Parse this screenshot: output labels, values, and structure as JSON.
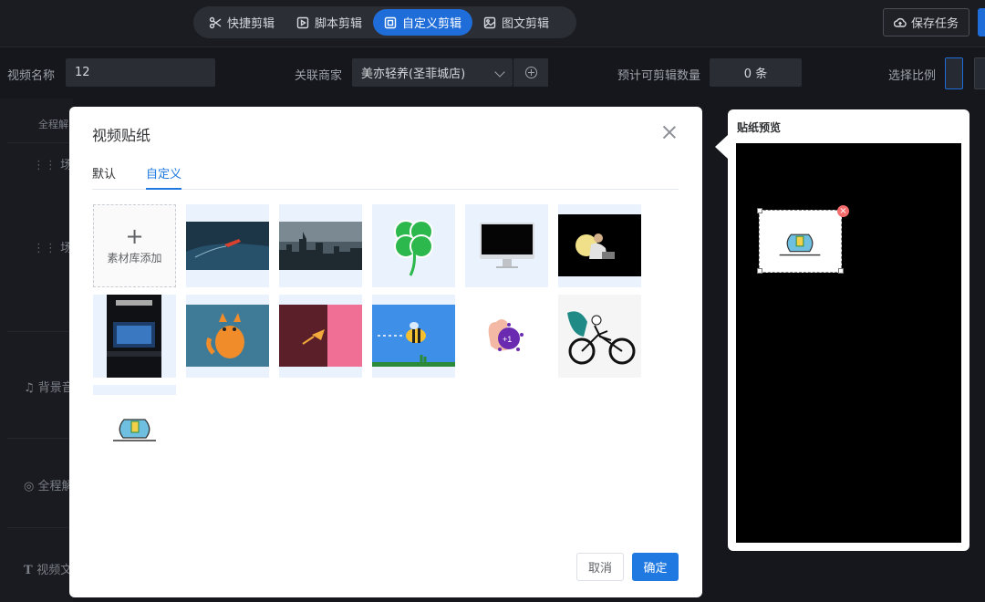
{
  "topbar": {
    "mode_tabs": [
      {
        "label": "快捷剪辑",
        "icon": "scissors-icon",
        "active": false
      },
      {
        "label": "脚本剪辑",
        "icon": "film-icon",
        "active": false
      },
      {
        "label": "自定义剪辑",
        "icon": "crop-icon",
        "active": true
      },
      {
        "label": "图文剪辑",
        "icon": "image-icon",
        "active": false
      }
    ],
    "save_label": "保存任务",
    "save_icon": "cloud-upload-icon",
    "accent": "#1f6dd8"
  },
  "form": {
    "video_name_label": "视频名称",
    "video_name_value": "12",
    "merchant_label": "关联商家",
    "merchant_value": "美亦轻养(圣菲城店)",
    "estimate_label": "预计可剪辑数量",
    "estimate_value": "0 条",
    "ratio_label": "选择比例"
  },
  "background_list": {
    "items": [
      "全程解",
      "场景",
      "场景",
      "背景音",
      "全程解",
      "视频文"
    ],
    "header_partial": "全程解"
  },
  "modal": {
    "title": "视频贴纸",
    "tabs": [
      {
        "label": "默认",
        "active": false
      },
      {
        "label": "自定义",
        "active": true
      }
    ],
    "add_tile": {
      "plus": "+",
      "label": "素材库添加"
    },
    "stickers": [
      {
        "name": "speedboat-ocean-thumb"
      },
      {
        "name": "city-skyline-thumb"
      },
      {
        "name": "four-leaf-clover-thumb"
      },
      {
        "name": "desktop-monitor-thumb"
      },
      {
        "name": "person-laptop-night-thumb"
      },
      {
        "name": "building-screen-thumb"
      },
      {
        "name": "orange-cat-thumb"
      },
      {
        "name": "pink-rocket-thumb"
      },
      {
        "name": "flying-bee-thumb"
      },
      {
        "name": "virus-hand-plus-one-thumb"
      },
      {
        "name": "cyclist-thumb"
      },
      {
        "name": "fishbowl-thumb"
      }
    ],
    "cancel_label": "取消",
    "confirm_label": "确定",
    "accent": "#1f79e0"
  },
  "preview": {
    "title": "贴纸预览",
    "delete_glyph": "×",
    "delete_color": "#f56c6c"
  }
}
